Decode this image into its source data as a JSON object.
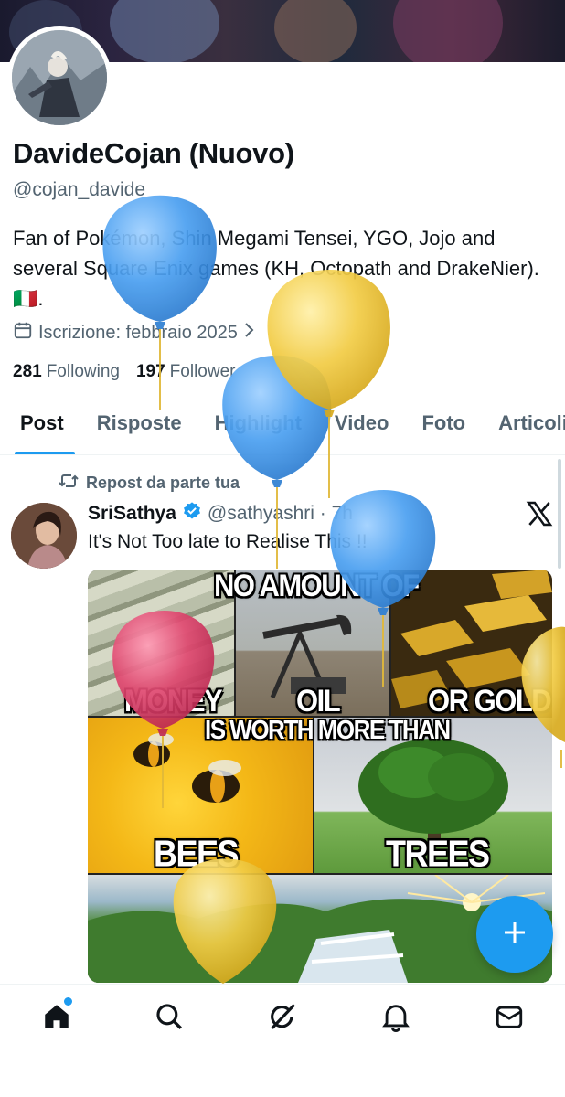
{
  "profile": {
    "name": "DavideCojan (Nuovo)",
    "handle": "@cojan_davide",
    "bio": "Fan of Pokémon, Shin Megami Tensei, YGO, Jojo and several Square Enix games (KH, Octopath and DrakeNier). 🇮🇹.",
    "join_label": "Iscrizione: febbraio 2025",
    "following_count": "281",
    "following_label": "Following",
    "followers_count": "197",
    "followers_label": "Follower"
  },
  "tabs": [
    {
      "label": "Post"
    },
    {
      "label": "Risposte"
    },
    {
      "label": "Highlight"
    },
    {
      "label": "Video"
    },
    {
      "label": "Foto"
    },
    {
      "label": "Articoli"
    }
  ],
  "post": {
    "repost_label": "Repost da parte tua",
    "author": "SriSathya",
    "handle_time": "@sathyashri · 7h",
    "text": "It's Not Too late to Realise This !!",
    "meme": {
      "top": "NO AMOUNT OF",
      "money": "MONEY",
      "oil": "OIL",
      "gold": "OR GOLD",
      "middle": "IS WORTH MORE THAN",
      "bees": "BEES",
      "trees": "TREES"
    }
  },
  "bottom_nav": {
    "items": [
      {
        "icon": "home-icon"
      },
      {
        "icon": "search-icon"
      },
      {
        "icon": "grok-icon"
      },
      {
        "icon": "bell-icon"
      },
      {
        "icon": "mail-icon"
      }
    ]
  },
  "colors": {
    "accent": "#1d9bf0",
    "balloon_blue": "#4a9ff0",
    "balloon_yellow": "#f2cc45",
    "balloon_pink": "#e04870"
  }
}
